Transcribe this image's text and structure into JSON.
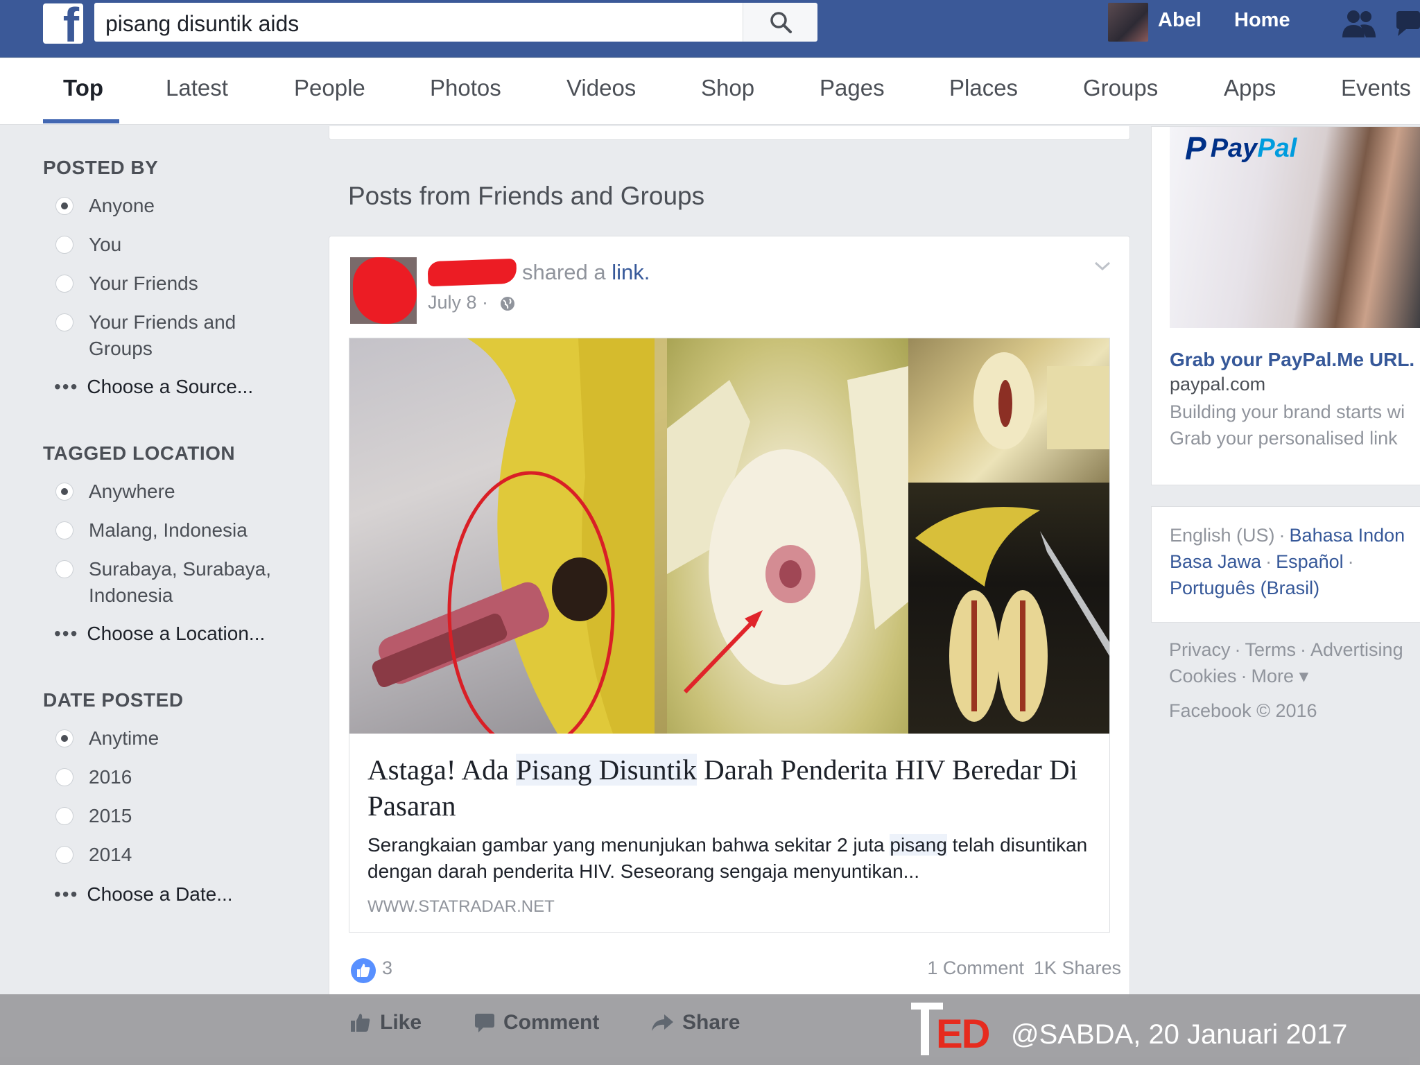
{
  "header": {
    "search_value": "pisang disuntik aids",
    "user_name": "Abel",
    "home_label": "Home"
  },
  "tabs": [
    {
      "label": "Top"
    },
    {
      "label": "Latest"
    },
    {
      "label": "People"
    },
    {
      "label": "Photos"
    },
    {
      "label": "Videos"
    },
    {
      "label": "Shop"
    },
    {
      "label": "Pages"
    },
    {
      "label": "Places"
    },
    {
      "label": "Groups"
    },
    {
      "label": "Apps"
    },
    {
      "label": "Events"
    }
  ],
  "filters": {
    "posted_by": {
      "title": "POSTED BY",
      "options": [
        "Anyone",
        "You",
        "Your Friends",
        "Your Friends and Groups"
      ],
      "more": "Choose a Source..."
    },
    "tagged_location": {
      "title": "TAGGED LOCATION",
      "options": [
        "Anywhere",
        "Malang, Indonesia",
        "Surabaya, Surabaya, Indonesia"
      ],
      "more": "Choose a Location..."
    },
    "date_posted": {
      "title": "DATE POSTED",
      "options": [
        "Anytime",
        "2016",
        "2015",
        "2014"
      ],
      "more": "Choose a Date..."
    }
  },
  "feed": {
    "section_title": "Posts from Friends and Groups",
    "post": {
      "shared_text": "shared a",
      "shared_link": "link.",
      "date": "July 8 ·",
      "link": {
        "title_part1": "Astaga! Ada ",
        "title_highlight": "Pisang Disuntik",
        "title_part2": " Darah Penderita HIV Beredar Di Pasaran",
        "desc_part1": "Serangkaian gambar yang menunjukan bahwa sekitar 2 juta ",
        "desc_highlight": "pisang",
        "desc_part2": " telah disuntikan dengan darah penderita HIV. Seseorang sengaja menyuntikan...",
        "domain": "WWW.STATRADAR.NET"
      },
      "likes": "3",
      "comments": "1 Comment",
      "shares": "1K Shares",
      "actions": {
        "like": "Like",
        "comment": "Comment",
        "share": "Share"
      }
    }
  },
  "sidebar_ad": {
    "logo_pay": "Pay",
    "logo_pal": "Pal",
    "title": "Grab your PayPal.Me URL.",
    "domain": "paypal.com",
    "body_line1": "Building your brand starts wi",
    "body_line2": "Grab your personalised link"
  },
  "languages": {
    "current": "English (US)",
    "others": [
      "Bahasa Indon",
      "Basa Jawa",
      "Español",
      "Português (Brasil)"
    ]
  },
  "footer": {
    "links": [
      "Privacy",
      "Terms",
      "Advertising",
      "Cookies",
      "More"
    ],
    "copyright": "Facebook © 2016"
  },
  "overlay": {
    "credit": "@SABDA, 20 Januari 2017",
    "ted_letters": "ED"
  }
}
